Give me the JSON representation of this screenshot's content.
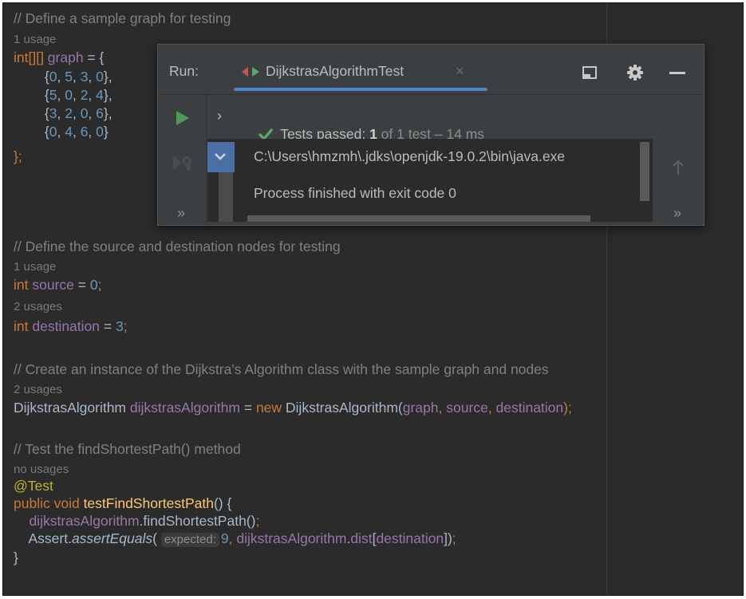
{
  "editor": {
    "lines": [
      {
        "text": "// Define a sample graph for testing"
      },
      {
        "hint": "1 usage"
      },
      {
        "tokens": [
          {
            "t": "int[][] ",
            "c": "k"
          },
          {
            "t": "graph",
            "c": "f"
          },
          {
            "t": " = {",
            "c": ""
          }
        ]
      },
      {
        "tokens": [
          {
            "t": "        {",
            "c": ""
          },
          {
            "t": "0",
            "c": "n"
          },
          {
            "t": ", ",
            "c": ""
          },
          {
            "t": "5",
            "c": "n"
          },
          {
            "t": ", ",
            "c": ""
          },
          {
            "t": "3",
            "c": "n"
          },
          {
            "t": ", ",
            "c": ""
          },
          {
            "t": "0",
            "c": "n"
          },
          {
            "t": "},",
            "c": ""
          }
        ]
      },
      {
        "tokens": [
          {
            "t": "        {",
            "c": ""
          },
          {
            "t": "5",
            "c": "n"
          },
          {
            "t": ", ",
            "c": ""
          },
          {
            "t": "0",
            "c": "n"
          },
          {
            "t": ", ",
            "c": ""
          },
          {
            "t": "2",
            "c": "n"
          },
          {
            "t": ", ",
            "c": ""
          },
          {
            "t": "4",
            "c": "n"
          },
          {
            "t": "},",
            "c": ""
          }
        ]
      },
      {
        "tokens": [
          {
            "t": "        {",
            "c": ""
          },
          {
            "t": "3",
            "c": "n"
          },
          {
            "t": ", ",
            "c": ""
          },
          {
            "t": "2",
            "c": "n"
          },
          {
            "t": ", ",
            "c": ""
          },
          {
            "t": "0",
            "c": "n"
          },
          {
            "t": ", ",
            "c": ""
          },
          {
            "t": "6",
            "c": "n"
          },
          {
            "t": "},",
            "c": ""
          }
        ]
      },
      {
        "tokens": [
          {
            "t": "        {",
            "c": ""
          },
          {
            "t": "0",
            "c": "n"
          },
          {
            "t": ", ",
            "c": ""
          },
          {
            "t": "4",
            "c": "n"
          },
          {
            "t": ", ",
            "c": ""
          },
          {
            "t": "6",
            "c": "n"
          },
          {
            "t": ", ",
            "c": ""
          },
          {
            "t": "0",
            "c": "n"
          },
          {
            "t": "}",
            "c": ""
          }
        ]
      },
      {
        "tokens": [
          {
            "t": "};",
            "c": "k"
          }
        ]
      },
      {
        "text": "// Define the source and destination nodes for testing"
      },
      {
        "hint": "1 usage"
      },
      {
        "tokens": [
          {
            "t": "int ",
            "c": "k"
          },
          {
            "t": "source",
            "c": "f"
          },
          {
            "t": " = ",
            "c": ""
          },
          {
            "t": "0",
            "c": "n"
          },
          {
            "t": ";",
            "c": "k"
          }
        ]
      },
      {
        "hint": "2 usages"
      },
      {
        "tokens": [
          {
            "t": "int ",
            "c": "k"
          },
          {
            "t": "destination",
            "c": "f"
          },
          {
            "t": " = ",
            "c": ""
          },
          {
            "t": "3",
            "c": "n"
          },
          {
            "t": ";",
            "c": "k"
          }
        ]
      },
      {
        "text": "// Create an instance of the Dijkstra's Algorithm class with the sample graph and nodes"
      },
      {
        "hint": "2 usages"
      },
      {
        "tokens": [
          {
            "t": "DijkstrasAlgorithm ",
            "c": ""
          },
          {
            "t": "dijkstrasAlgorithm",
            "c": "f"
          },
          {
            "t": " = ",
            "c": ""
          },
          {
            "t": "new ",
            "c": "k"
          },
          {
            "t": "DijkstrasAlgorithm(",
            "c": ""
          },
          {
            "t": "graph",
            "c": "f"
          },
          {
            "t": ", ",
            "c": "k"
          },
          {
            "t": "source",
            "c": "f"
          },
          {
            "t": ", ",
            "c": "k"
          },
          {
            "t": "destination",
            "c": "f"
          },
          {
            "t": ");",
            "c": "k"
          }
        ]
      },
      {
        "text": "// Test the findShortestPath() method"
      },
      {
        "hint": "no usages"
      },
      {
        "tokens": [
          {
            "t": "@Test",
            "c": "an"
          }
        ]
      },
      {
        "tokens": [
          {
            "t": "public void ",
            "c": "k"
          },
          {
            "t": "testFindShortestPath",
            "c": "fn"
          },
          {
            "t": "() {",
            "c": ""
          }
        ]
      },
      {
        "tokens": [
          {
            "t": "    ",
            "c": ""
          },
          {
            "t": "dijkstrasAlgorithm",
            "c": "f"
          },
          {
            "t": ".findShortestPath()",
            "c": ""
          },
          {
            "t": ";",
            "c": "k"
          }
        ]
      },
      {
        "tokens": [
          {
            "t": "    Assert.",
            "c": ""
          },
          {
            "t": "assertEquals",
            "c": "i"
          },
          {
            "t": "( ",
            "c": ""
          },
          {
            "inlay": "expected:"
          },
          {
            "t": "9",
            "c": "n"
          },
          {
            "t": ", ",
            "c": "k"
          },
          {
            "t": "dijkstrasAlgorithm",
            "c": "f"
          },
          {
            "t": ".",
            "c": ""
          },
          {
            "t": "dist",
            "c": "f"
          },
          {
            "t": "[",
            "c": ""
          },
          {
            "t": "destination",
            "c": "f"
          },
          {
            "t": "])",
            "c": ""
          },
          {
            "t": ";",
            "c": "k"
          }
        ]
      },
      {
        "tokens": [
          {
            "t": "}",
            "c": ""
          }
        ]
      }
    ]
  },
  "run_panel": {
    "label": "Run:",
    "tab_label": "DijkstrasAlgorithmTest",
    "tab_close": "×",
    "result_prefix": "Tests passed: ",
    "result_count": "1",
    "result_suffix": " of 1 test – 14 ms",
    "console_command": "C:\\Users\\hmzmh\\.jdks\\openjdk-19.0.2\\bin\\java.exe",
    "console_exit": "Process finished with exit code 0",
    "more_left": "»",
    "more_right": "»",
    "icons": {
      "tab": "java-class-icon",
      "layout": "layout-icon",
      "settings": "gear-icon",
      "hide": "minimize-icon",
      "rerun": "play-icon",
      "rerun_failed": "rerun-failed-icon",
      "expand": "chevron-down-icon",
      "scroll_up": "arrow-up-icon",
      "passed": "check-icon"
    },
    "colors": {
      "accent": "#4a88c7",
      "passed": "#59a869",
      "play": "#499c54"
    }
  }
}
